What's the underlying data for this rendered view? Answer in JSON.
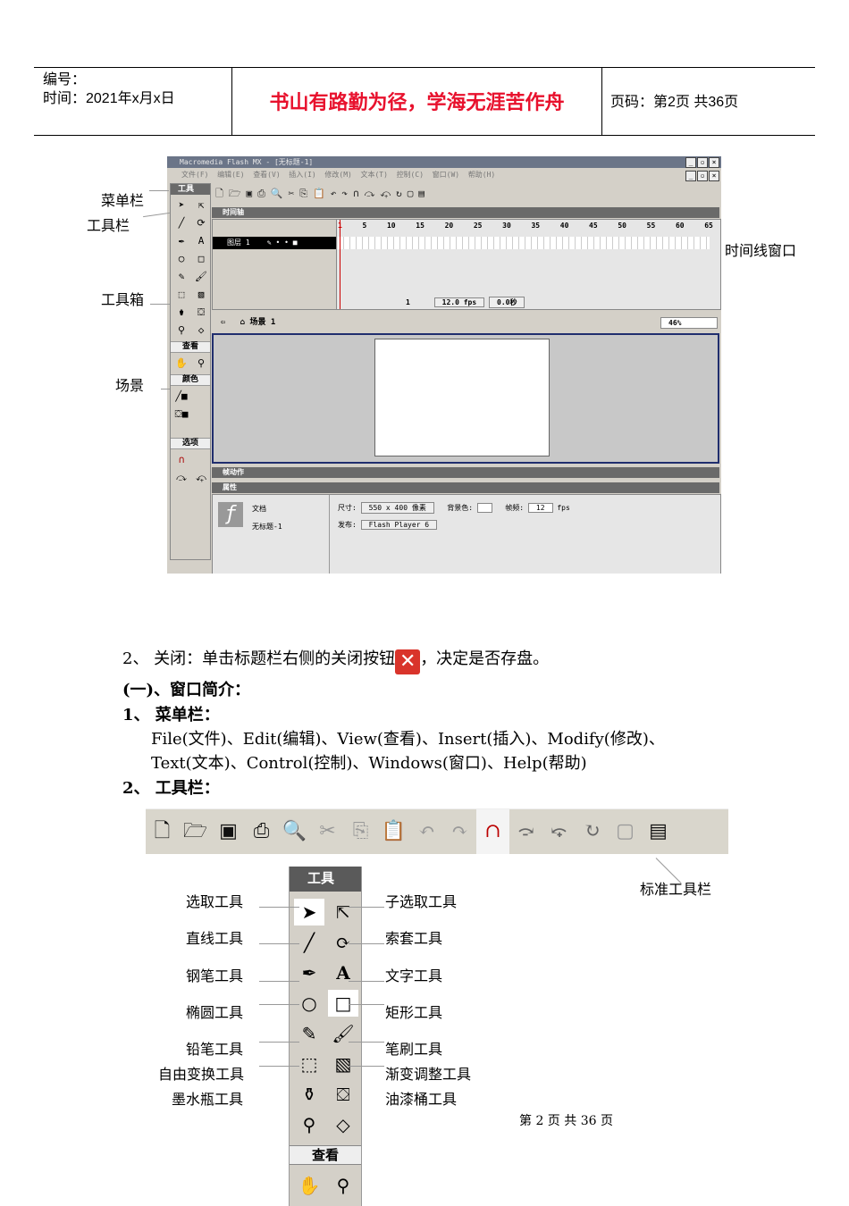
{
  "header": {
    "number_label": "编号：",
    "time_label": "时间：2021年x月x日",
    "motto": "书山有路勤为径，学海无涯苦作舟",
    "page_info": "页码：第2页  共36页"
  },
  "screenshot": {
    "window_title": "Macromedia Flash MX - [无标题-1]",
    "menu_items": [
      "文件(F)",
      "编辑(E)",
      "查看(V)",
      "插入(I)",
      "修改(M)",
      "文本(T)",
      "控制(C)",
      "窗口(W)",
      "帮助(H)"
    ],
    "tools_panel_title": "工具",
    "view_section": "查看",
    "color_section": "颜色",
    "options_section": "选项",
    "timeline_title": "时间轴",
    "layer_name": "图层 1",
    "frame_numbers": [
      "1",
      "5",
      "10",
      "15",
      "20",
      "25",
      "30",
      "35",
      "40",
      "45",
      "50",
      "55",
      "60",
      "65"
    ],
    "current_frame": "1",
    "fps_display": "12.0 fps",
    "time_display": "0.0秒",
    "scene_name": "场景 1",
    "zoom": "46%",
    "actions_title": "帧动作",
    "properties_title": "属性",
    "doc_type": "文档",
    "doc_name": "无标题-1",
    "size_label": "尺寸:",
    "size_value": "550 x 400 像素",
    "bg_label": "背景色:",
    "framerate_label": "帧频:",
    "framerate_value": "12",
    "fps_unit": "fps",
    "publish_label": "发布:",
    "publish_value": "Flash Player 6"
  },
  "annotations": {
    "menubar": "菜单栏",
    "toolbar": "工具栏",
    "toolbox": "工具箱",
    "scene": "场景",
    "timeline_window": "时间线窗口"
  },
  "body": {
    "close_text_before": "2、 关闭：单击标题栏右侧的关闭按钮",
    "close_text_after": "，决定是否存盘。",
    "section_heading": "(一)、窗口简介：",
    "item1_heading": "1、 菜单栏：",
    "menus_line1": "File(文件)、Edit(编辑)、View(查看)、Insert(插入)、Modify(修改)、",
    "menus_line2": "Text(文本)、Control(控制)、Windows(窗口)、Help(帮助)",
    "item2_heading": "2、 工具栏："
  },
  "toolbar_strip_label": "标准工具栏",
  "toolbox": {
    "title": "工具",
    "view_section": "查看",
    "left_labels": [
      "选取工具",
      "直线工具",
      "钢笔工具",
      "椭圆工具",
      "铅笔工具",
      "自由变换工具",
      "墨水瓶工具"
    ],
    "right_labels": [
      "子选取工具",
      "索套工具",
      "文字工具",
      "矩形工具",
      "笔刷工具",
      "渐变调整工具",
      "油漆桶工具"
    ]
  },
  "footer": "第 2 页 共 36 页",
  "colors": {
    "motto": "#e8112d",
    "close_button": "#d9342b"
  }
}
